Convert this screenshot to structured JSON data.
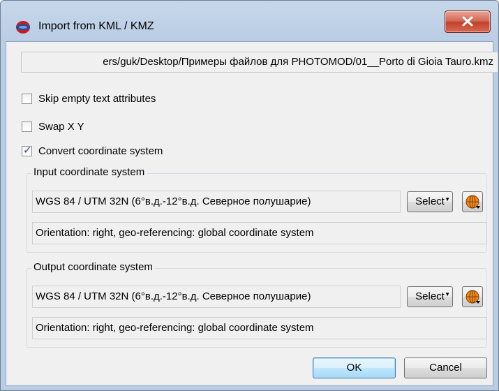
{
  "window": {
    "title": "Import from KML / KMZ",
    "close_symbol": "X"
  },
  "file_path": "ers/guk/Desktop/Примеры файлов для PHOTOMOD/01__Porto di Gioia Tauro.kmz",
  "options": [
    {
      "label": "Skip empty text attributes",
      "checked": false
    },
    {
      "label": "Swap X Y",
      "checked": false
    },
    {
      "label": "Convert coordinate system",
      "checked": true
    }
  ],
  "input_cs": {
    "title": "Input coordinate system",
    "value": "WGS 84 / UTM 32N (6°в.д.-12°в.д. Северное полушарие)",
    "select_label": "Select",
    "info": "Orientation: right, geo-referencing: global coordinate system"
  },
  "output_cs": {
    "title": "Output coordinate system",
    "value": "WGS 84 / UTM 32N (6°в.д.-12°в.д. Северное полушарие)",
    "select_label": "Select",
    "info": "Orientation: right, geo-referencing: global coordinate system"
  },
  "buttons": {
    "ok": "OK",
    "cancel": "Cancel"
  },
  "icons": {
    "app": "photomod-app-icon",
    "close": "close-icon",
    "globe": "globe-icon",
    "dropdown": "dropdown-arrow-icon"
  }
}
